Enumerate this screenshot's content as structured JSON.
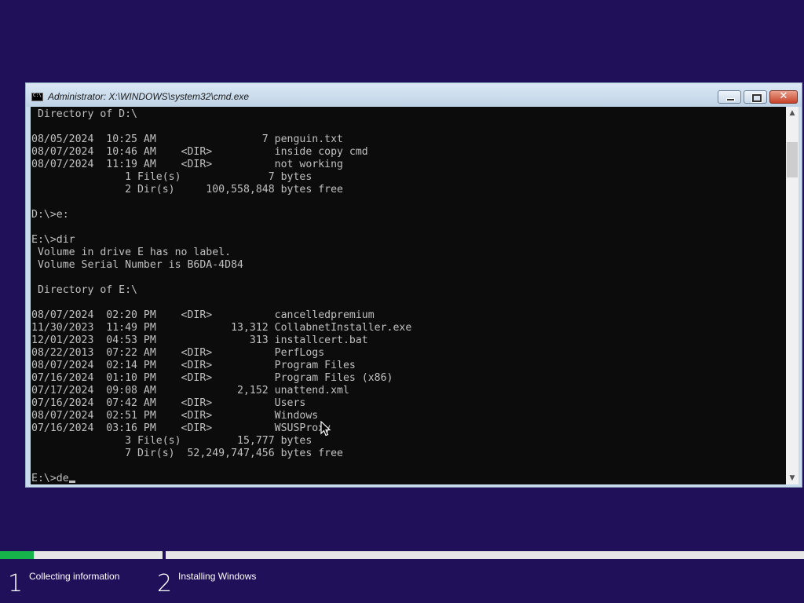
{
  "window": {
    "title": "Administrator: X:\\WINDOWS\\system32\\cmd.exe",
    "close_glyph": "✕"
  },
  "console": {
    "lines": [
      " Directory of D:\\",
      "",
      "08/05/2024  10:25 AM                 7 penguin.txt",
      "08/07/2024  10:46 AM    <DIR>          inside copy cmd",
      "08/07/2024  11:19 AM    <DIR>          not working",
      "               1 File(s)              7 bytes",
      "               2 Dir(s)     100,558,848 bytes free",
      "",
      "D:\\>e:",
      "",
      "E:\\>dir",
      " Volume in drive E has no label.",
      " Volume Serial Number is B6DA-4D84",
      "",
      " Directory of E:\\",
      "",
      "08/07/2024  02:20 PM    <DIR>          cancelledpremium",
      "11/30/2023  11:49 PM            13,312 CollabnetInstaller.exe",
      "12/01/2023  04:53 PM               313 installcert.bat",
      "08/22/2013  07:22 AM    <DIR>          PerfLogs",
      "08/07/2024  02:14 PM    <DIR>          Program Files",
      "07/16/2024  01:10 PM    <DIR>          Program Files (x86)",
      "07/17/2024  09:08 AM             2,152 unattend.xml",
      "07/16/2024  07:42 AM    <DIR>          Users",
      "08/07/2024  02:51 PM    <DIR>          Windows",
      "07/16/2024  03:16 PM    <DIR>          WSUSProxy",
      "               3 File(s)         15,777 bytes",
      "               7 Dir(s)  52,249,747,456 bytes free",
      ""
    ],
    "prompt_line": "E:\\>de"
  },
  "scrollbar": {
    "up_glyph": "▲",
    "down_glyph": "▼"
  },
  "setup": {
    "progress_step1": 0.21,
    "steps": [
      {
        "number": "1",
        "label": "Collecting information"
      },
      {
        "number": "2",
        "label": "Installing Windows"
      }
    ]
  }
}
